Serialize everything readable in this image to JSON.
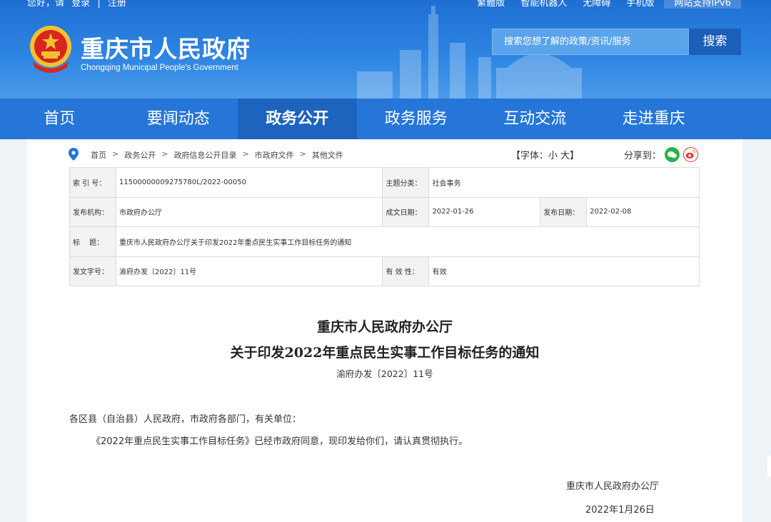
{
  "topbar": {
    "greeting": "您好，请",
    "login": "登录",
    "divider": "|",
    "register": "注册",
    "links": [
      "繁體版",
      "智能机器人",
      "无障碍",
      "手机版"
    ],
    "ipv6": "网站支持IPv6"
  },
  "header": {
    "title": "重庆市人民政府",
    "subtitle": "Chongqing Municipal People's Government",
    "search_placeholder": "搜索您想了解的政策/资讯/服务",
    "search_button": "搜索"
  },
  "nav": {
    "items": [
      "首页",
      "要闻动态",
      "政务公开",
      "政务服务",
      "互动交流",
      "走进重庆"
    ],
    "active_index": 2
  },
  "breadcrumb": {
    "items": [
      "首页",
      "政务公开",
      "政府信息公开目录",
      "市政府文件",
      "其他文件"
    ],
    "separator": ">"
  },
  "tools": {
    "font_label": "【字体：小 大】",
    "share_label": "分享到："
  },
  "meta": {
    "index_label": "索 引 号：",
    "index_value": "11500000009275780L/2022-00050",
    "topic_label": "主题分类：",
    "topic_value": "社会事务",
    "org_label": "发布机构：",
    "org_value": "市政府办公厅",
    "written_label": "成文日期：",
    "written_value": "2022-01-26",
    "pub_label": "发布日期：",
    "pub_value": "2022-02-08",
    "title_label": "标　 题：",
    "title_value": "重庆市人民政府办公厅关于印发2022年重点民生实事工作目标任务的通知",
    "docno_label": "发文字号：",
    "docno_value": "渝府办发〔2022〕11号",
    "valid_label": "有 效 性：",
    "valid_value": "有效"
  },
  "document": {
    "title_line1": "重庆市人民政府办公厅",
    "title_line2": "关于印发2022年重点民生实事工作目标任务的通知",
    "doc_number": "渝府办发〔2022〕11号",
    "addressee": "各区县（自治县）人民政府，市政府各部门，有关单位：",
    "body": "《2022年重点民生实事工作目标任务》已经市政府同意，现印发给你们，请认真贯彻执行。",
    "sign_org": "重庆市人民政府办公厅",
    "sign_date": "2022年1月26日"
  },
  "colors": {
    "header_blue": "#2f86e3",
    "nav_blue": "#2576d8",
    "nav_active": "#1e63bd",
    "search_button": "#1c5fb9"
  }
}
